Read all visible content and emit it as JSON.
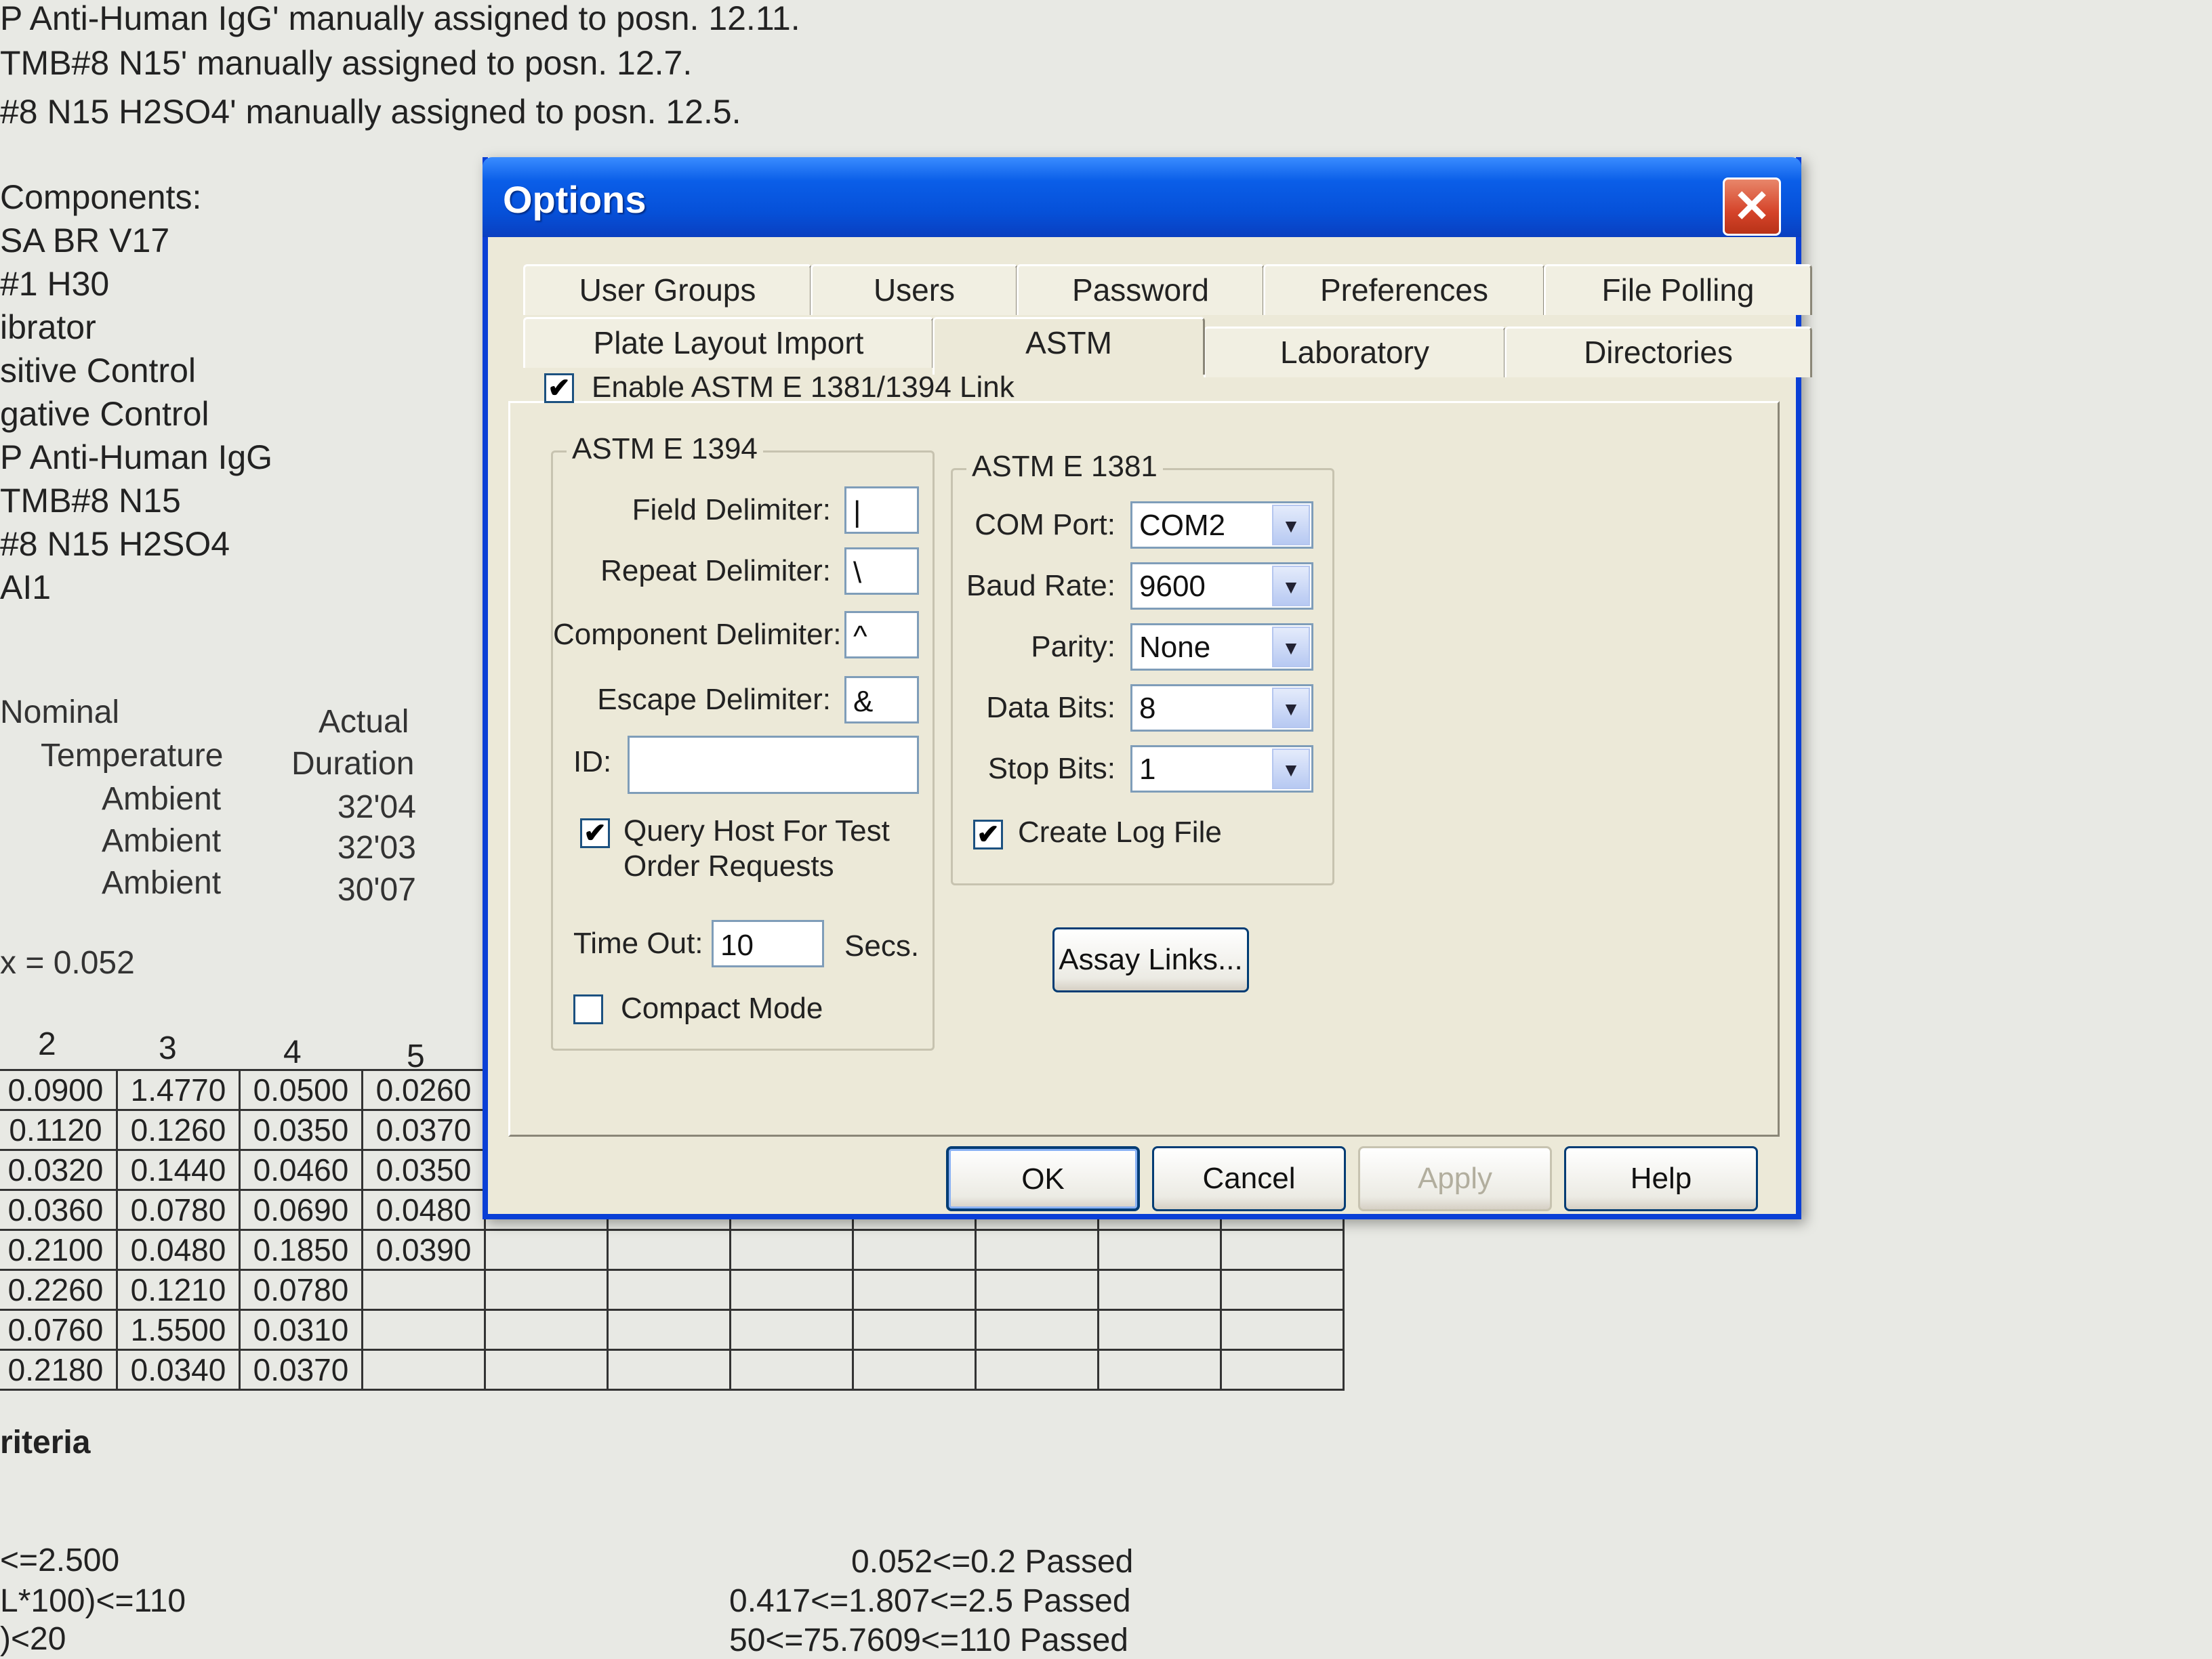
{
  "report": {
    "log_lines": [
      "P Anti-Human IgG' manually assigned to posn. 12.11.",
      "TMB#8 N15' manually assigned to posn. 12.7.",
      "#8 N15 H2SO4' manually assigned to posn. 12.5."
    ],
    "components_heading": "Components:",
    "components": [
      "SA BR V17",
      "#1 H30",
      "ibrator",
      "sitive Control",
      "gative Control",
      "P Anti-Human IgG",
      "TMB#8 N15",
      "#8 N15 H2SO4",
      "AI1"
    ],
    "nominal_label": "Nominal",
    "temperature_label": "Temperature",
    "actual_label": "Actual",
    "duration_label": "Duration",
    "incubations": [
      {
        "temperature": "Ambient",
        "duration": "32'04"
      },
      {
        "temperature": "Ambient",
        "duration": "32'03"
      },
      {
        "temperature": "Ambient",
        "duration": "30'07"
      }
    ],
    "x_value": "x = 0.052",
    "column_numbers": [
      "2",
      "3",
      "4",
      "5"
    ],
    "grid": [
      [
        "0.0900",
        "1.4770",
        "0.0500",
        "0.0260"
      ],
      [
        "0.1120",
        "0.1260",
        "0.0350",
        "0.0370"
      ],
      [
        "0.0320",
        "0.1440",
        "0.0460",
        "0.0350"
      ],
      [
        "0.0360",
        "0.0780",
        "0.0690",
        "0.0480"
      ],
      [
        "0.2100",
        "0.0480",
        "0.1850",
        "0.0390"
      ],
      [
        "0.2260",
        "0.1210",
        "0.0780",
        ""
      ],
      [
        "0.0760",
        "1.5500",
        "0.0310",
        ""
      ],
      [
        "0.2180",
        "0.0340",
        "0.0370",
        ""
      ]
    ],
    "criteria_heading": "riteria",
    "criteria_left": [
      "<=2.500",
      "L*100)<=110",
      ")<20"
    ],
    "criteria_right": [
      "0.052<=0.2  Passed",
      "0.417<=1.807<=2.5  Passed",
      "50<=75.7609<=110  Passed"
    ]
  },
  "dialog": {
    "title": "Options",
    "close_glyph": "✕",
    "tabs_row1": [
      "User Groups",
      "Users",
      "Password",
      "Preferences",
      "File Polling"
    ],
    "tabs_row2": [
      "Plate Layout Import",
      "ASTM",
      "Laboratory",
      "Directories"
    ],
    "active_tab": "ASTM",
    "enable_link": {
      "label": "Enable ASTM E 1381/1394 Link",
      "checked": true
    },
    "e1394": {
      "title": "ASTM E 1394",
      "field_delimiter_label": "Field Delimiter:",
      "field_delimiter": "|",
      "repeat_delimiter_label": "Repeat Delimiter:",
      "repeat_delimiter": "\\",
      "component_delimiter_label": "Component Delimiter:",
      "component_delimiter": "^",
      "escape_delimiter_label": "Escape Delimiter:",
      "escape_delimiter": "&",
      "id_label": "ID:",
      "id_value": "",
      "query_host_label_1": "Query Host For Test",
      "query_host_label_2": "Order Requests",
      "query_host_checked": true,
      "timeout_label": "Time Out:",
      "timeout_value": "10",
      "timeout_unit": "Secs.",
      "compact_mode_label": "Compact Mode",
      "compact_mode_checked": false
    },
    "e1381": {
      "title": "ASTM E 1381",
      "com_port_label": "COM Port:",
      "com_port": "COM2",
      "baud_rate_label": "Baud Rate:",
      "baud_rate": "9600",
      "parity_label": "Parity:",
      "parity": "None",
      "data_bits_label": "Data Bits:",
      "data_bits": "8",
      "stop_bits_label": "Stop Bits:",
      "stop_bits": "1",
      "create_log_label": "Create Log File",
      "create_log_checked": true
    },
    "assay_links_label": "Assay Links...",
    "buttons": {
      "ok": "OK",
      "cancel": "Cancel",
      "apply": "Apply",
      "help": "Help"
    },
    "check_glyph": "✔",
    "dropdown_glyph": "▼"
  }
}
